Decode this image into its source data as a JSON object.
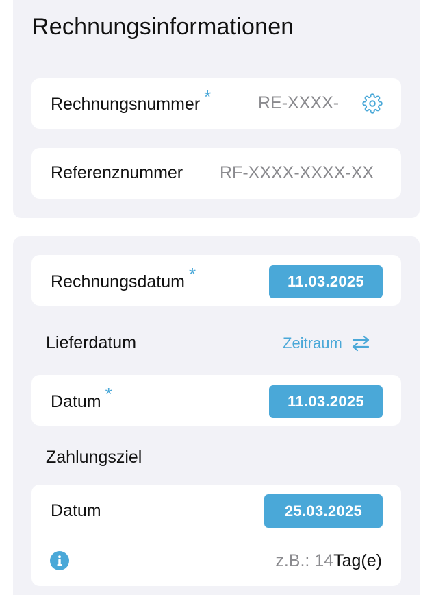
{
  "invoice_info": {
    "title": "Rechnungsinformationen",
    "invoice_number": {
      "label": "Rechnungsnummer",
      "required_marker": "*",
      "placeholder": "RE-XXXX-"
    },
    "reference_number": {
      "label": "Referenznummer",
      "placeholder": "RF-XXXX-XXXX-XX"
    }
  },
  "dates": {
    "invoice_date": {
      "label": "Rechnungsdatum",
      "required_marker": "*",
      "value": "11.03.2025"
    },
    "delivery": {
      "section_label": "Lieferdatum",
      "range_link": "Zeitraum",
      "date_label": "Datum",
      "required_marker": "*",
      "value": "11.03.2025"
    },
    "payment_term": {
      "section_label": "Zahlungsziel",
      "date_label": "Datum",
      "value": "25.03.2025",
      "hint_prefix": "z.B.: 14",
      "hint_suffix": "Tag(e)"
    }
  },
  "colors": {
    "accent": "#4aa8d8",
    "panel_bg": "#f2f2f7",
    "placeholder": "#8a8a8e"
  },
  "icons": [
    "gear-icon",
    "swap-arrows-icon",
    "info-icon"
  ]
}
